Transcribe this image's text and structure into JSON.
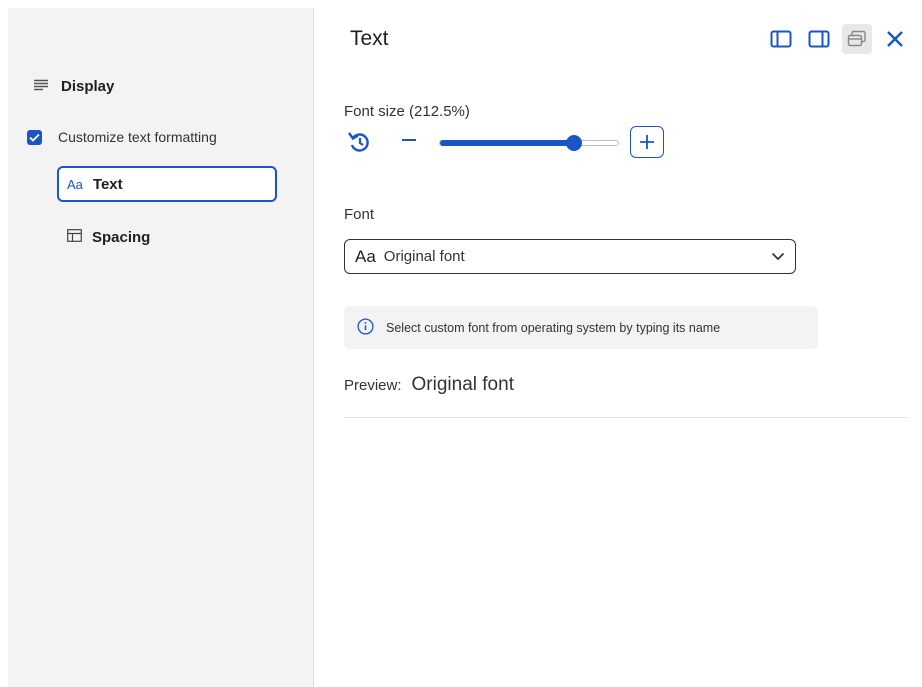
{
  "sidebar": {
    "heading": "Display",
    "checkbox_label": "Customize text formatting",
    "checkbox_checked": true,
    "items": [
      {
        "icon_text": "Aa",
        "label": "Text",
        "selected": true
      },
      {
        "icon": "layout-icon",
        "label": "Spacing",
        "selected": false
      }
    ]
  },
  "header": {
    "title": "Text",
    "icons": [
      "sidebar-left-icon",
      "sidebar-right-icon",
      "popout-window-icon",
      "close-icon"
    ]
  },
  "font_size": {
    "label": "Font size (212.5%)",
    "value_fraction": 0.75
  },
  "font": {
    "label": "Font",
    "icon_text": "Aa",
    "selected_value": "Original font"
  },
  "info": {
    "text": "Select custom font from operating system by typing its name"
  },
  "preview": {
    "label": "Preview:",
    "value": "Original font"
  },
  "colors": {
    "accent": "#1a56c5",
    "sidebar_bg": "#f3f3f3"
  }
}
